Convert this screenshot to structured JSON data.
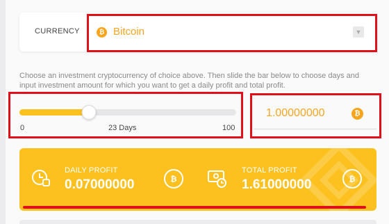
{
  "currency": {
    "label": "CURRENCY",
    "selected": "Bitcoin",
    "coin_symbol": "₿"
  },
  "instructions": "Choose an investment cryptocurrency of choice above. Then slide the bar below to choose days and input investment amount for which you want to get a daily profit and total profit.",
  "slider": {
    "min": "0",
    "max": "100",
    "current_label": "23 Days",
    "value_fraction": 0.23
  },
  "amount": {
    "value": "1.00000000",
    "coin_symbol": "₿"
  },
  "results": {
    "daily_label": "DAILY PROFIT",
    "daily_value": "0.07000000",
    "total_label": "TOTAL PROFIT",
    "total_value": "1.61000000",
    "coin_symbol": "₿"
  },
  "colors": {
    "accent": "#fcc11e",
    "currency_text": "#f5a623",
    "highlight": "#e0101a"
  }
}
